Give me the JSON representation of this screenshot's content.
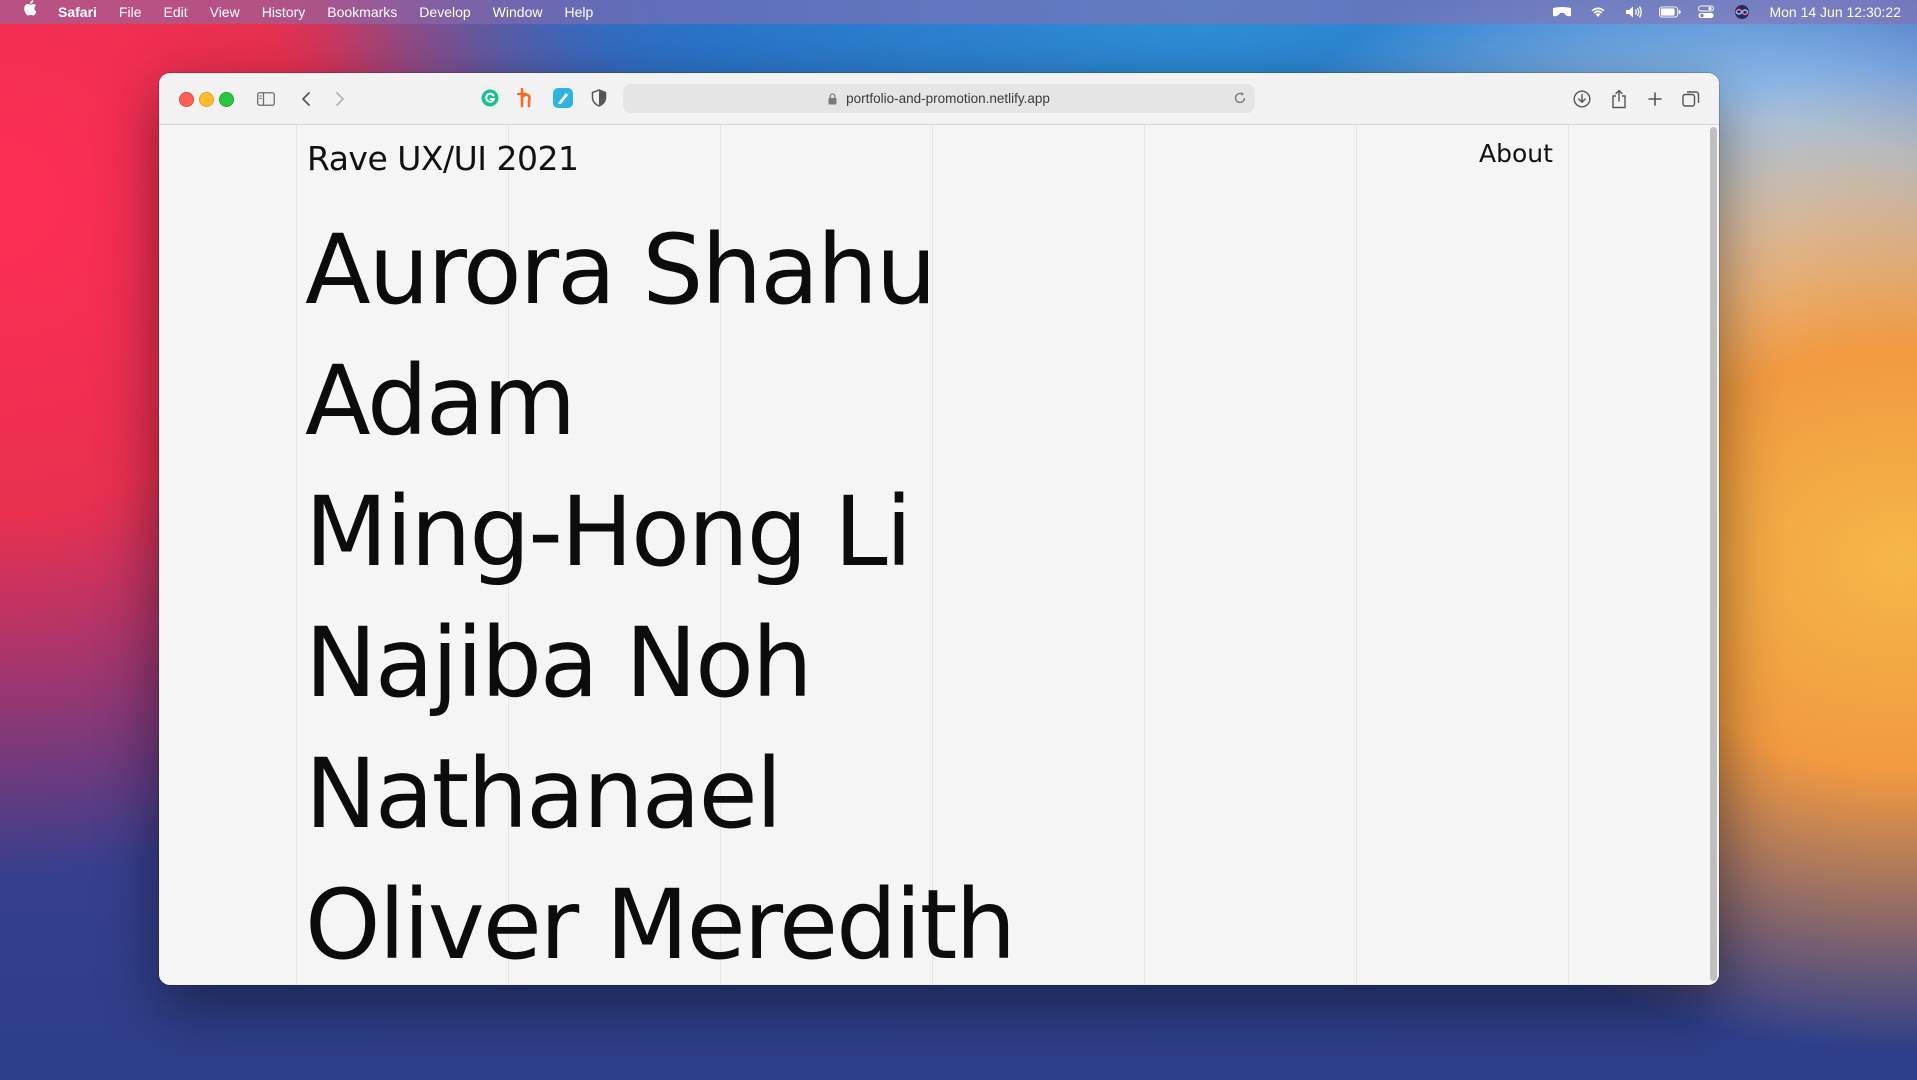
{
  "menubar": {
    "app_name": "Safari",
    "items": [
      "File",
      "Edit",
      "View",
      "History",
      "Bookmarks",
      "Develop",
      "Window",
      "Help"
    ],
    "status_icons": [
      "bluetooth-headphones-icon",
      "wifi-icon",
      "volume-icon",
      "battery-icon",
      "control-center-icon",
      "siri-icon"
    ],
    "clock": "Mon 14 Jun  12:30:22"
  },
  "browser": {
    "url": "portfolio-and-promotion.netlify.app",
    "extensions": [
      {
        "name": "grammarly-extension-icon",
        "color": "#15c39a"
      },
      {
        "name": "honey-extension-icon",
        "color": "#f26c25"
      },
      {
        "name": "notes-extension-icon",
        "color": "#2fb3e0"
      },
      {
        "name": "privacy-shield-icon",
        "color": "#555555"
      }
    ]
  },
  "site": {
    "title": "Rave UX/UI 2021",
    "nav_about": "About",
    "names": [
      "Aurora Shahu",
      "Adam",
      "Ming-Hong Li",
      "Najiba Noh",
      "Nathanael",
      "Oliver Meredith"
    ]
  }
}
